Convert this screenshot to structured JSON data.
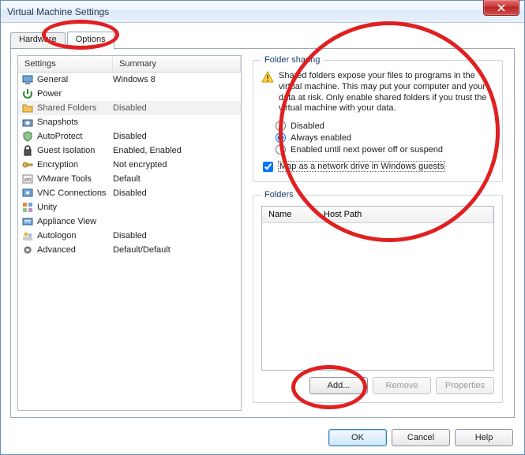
{
  "window": {
    "title": "Virtual Machine Settings"
  },
  "tabs": {
    "hardware": "Hardware",
    "options": "Options",
    "active": "options"
  },
  "listHeader": {
    "settings": "Settings",
    "summary": "Summary"
  },
  "settings": [
    {
      "icon": "monitor",
      "name": "General",
      "summary": "Windows 8"
    },
    {
      "icon": "power",
      "name": "Power",
      "summary": ""
    },
    {
      "icon": "folder",
      "name": "Shared Folders",
      "summary": "Disabled",
      "selected": true
    },
    {
      "icon": "camera",
      "name": "Snapshots",
      "summary": ""
    },
    {
      "icon": "shield",
      "name": "AutoProtect",
      "summary": "Disabled"
    },
    {
      "icon": "lock",
      "name": "Guest Isolation",
      "summary": "Enabled, Enabled"
    },
    {
      "icon": "key",
      "name": "Encryption",
      "summary": "Not encrypted"
    },
    {
      "icon": "vm",
      "name": "VMware Tools",
      "summary": "Default"
    },
    {
      "icon": "vnc",
      "name": "VNC Connections",
      "summary": "Disabled"
    },
    {
      "icon": "unity",
      "name": "Unity",
      "summary": ""
    },
    {
      "icon": "appliance",
      "name": "Appliance View",
      "summary": ""
    },
    {
      "icon": "users",
      "name": "Autologon",
      "summary": "Disabled"
    },
    {
      "icon": "gear",
      "name": "Advanced",
      "summary": "Default/Default"
    }
  ],
  "folderSharing": {
    "legend": "Folder sharing",
    "warning": "Shared folders expose your files to programs in the virtual machine. This may put your computer and your data at risk. Only enable shared folders if you trust the virtual machine with your data.",
    "options": {
      "disabled": "Disabled",
      "always": "Always enabled",
      "until": "Enabled until next power off or suspend"
    },
    "selected": "always",
    "mapDrive": {
      "label": "Map as a network drive in Windows guests",
      "checked": true
    }
  },
  "folders": {
    "legend": "Folders",
    "columns": {
      "name": "Name",
      "host": "Host Path"
    },
    "rows": [],
    "buttons": {
      "add": "Add...",
      "remove": "Remove",
      "properties": "Properties"
    }
  },
  "dialogButtons": {
    "ok": "OK",
    "cancel": "Cancel",
    "help": "Help"
  },
  "colors": {
    "accent": "#1a6fd6",
    "ring": "#e02020"
  }
}
